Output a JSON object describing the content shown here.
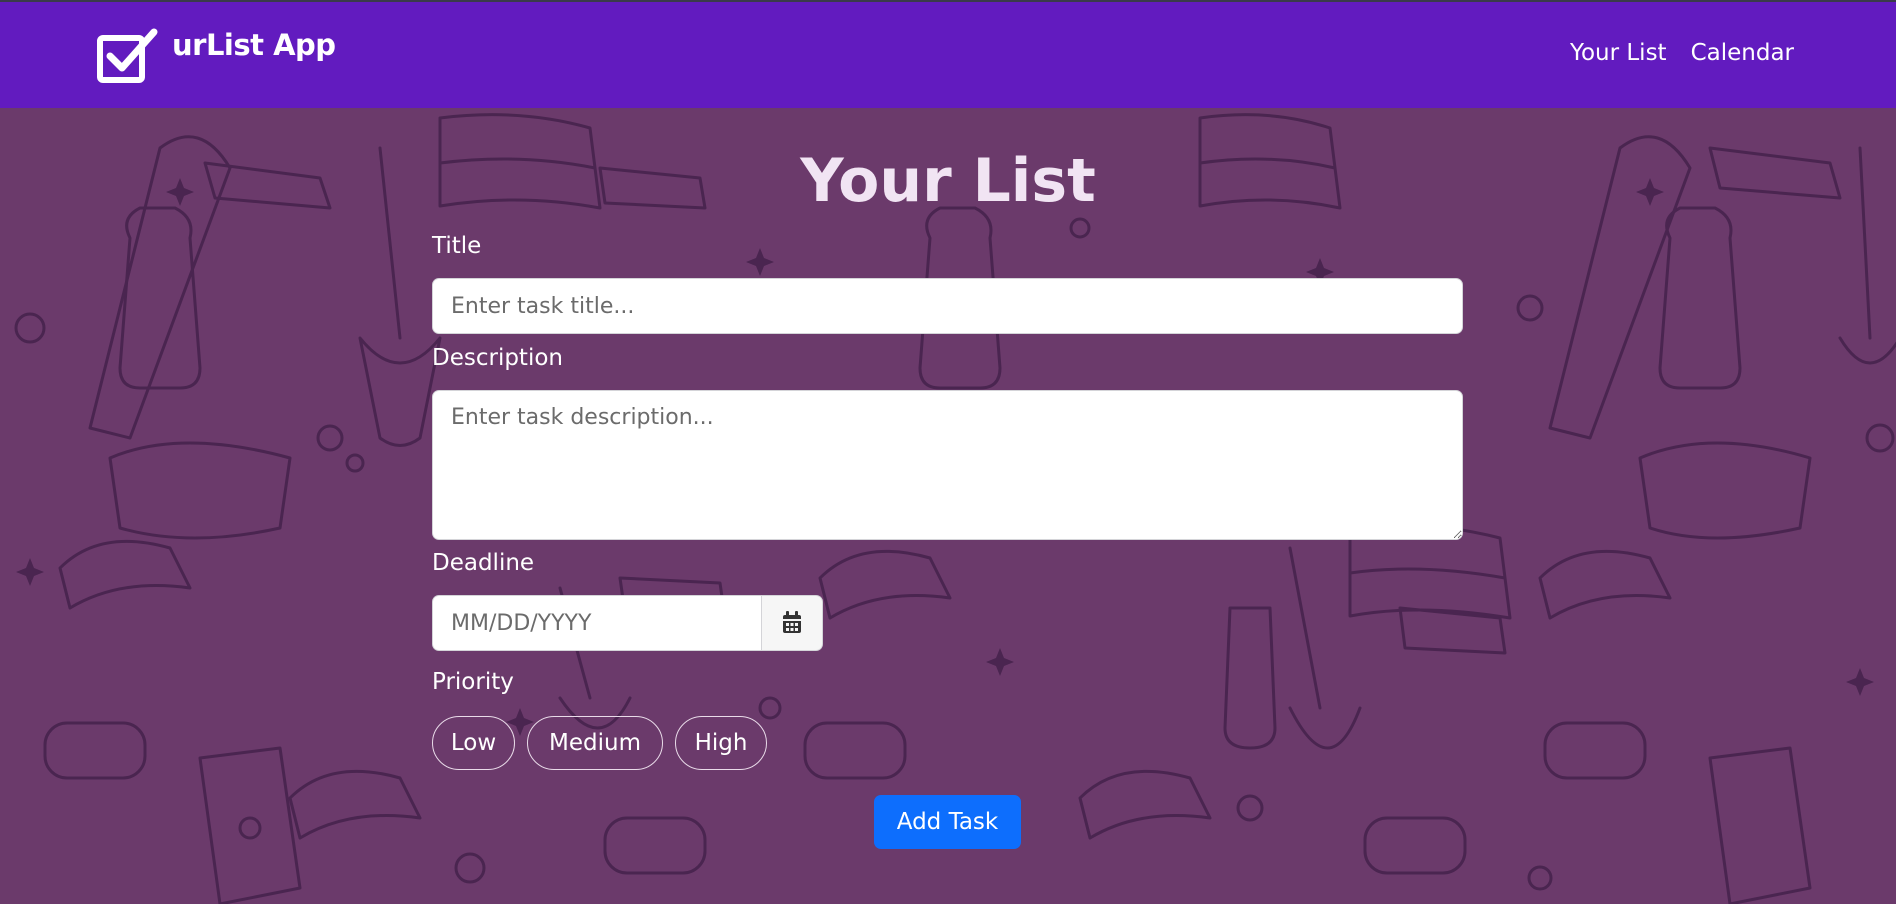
{
  "app": {
    "name": "urList App",
    "logo_icon": "checkbox-logo-icon"
  },
  "nav": {
    "links": [
      {
        "label": "Your List"
      },
      {
        "label": "Calendar"
      }
    ]
  },
  "main": {
    "title": "Your List",
    "fields": {
      "title": {
        "label": "Title",
        "placeholder": "Enter task title...",
        "value": ""
      },
      "description": {
        "label": "Description",
        "placeholder": "Enter task description...",
        "value": ""
      },
      "deadline": {
        "label": "Deadline",
        "placeholder": "MM/DD/YYYY",
        "value": "",
        "button_icon": "calendar-icon"
      },
      "priority": {
        "label": "Priority",
        "options": [
          {
            "label": "Low"
          },
          {
            "label": "Medium"
          },
          {
            "label": "High"
          }
        ]
      }
    },
    "submit_label": "Add Task"
  },
  "colors": {
    "navbar": "#621bbf",
    "background": "#6b3a6b",
    "pattern_line": "#4a2550",
    "submit_button": "#0d6efd"
  }
}
